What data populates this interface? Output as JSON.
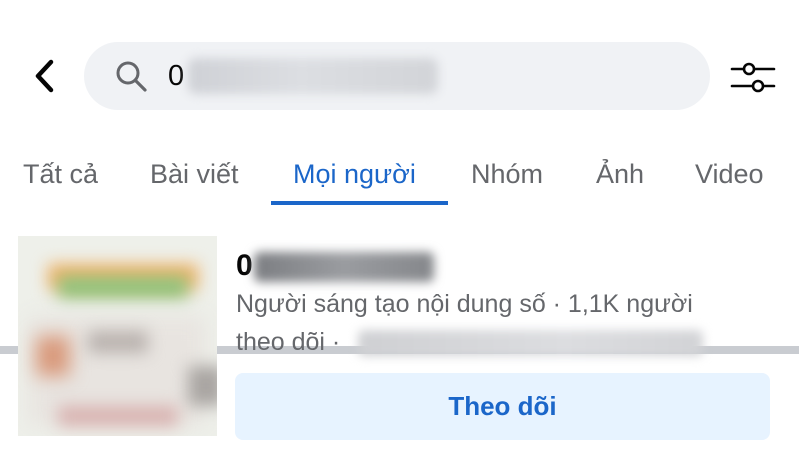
{
  "header": {
    "back_icon": "chevron-left-icon",
    "search": {
      "icon": "search-icon",
      "value": "0",
      "value_redacted": true
    },
    "filter_icon": "sliders-icon"
  },
  "tabs": [
    {
      "label": "Tất cả",
      "active": false
    },
    {
      "label": "Bài viết",
      "active": false
    },
    {
      "label": "Mọi người",
      "active": true
    },
    {
      "label": "Nhóm",
      "active": false
    },
    {
      "label": "Ảnh",
      "active": false
    },
    {
      "label": "Video",
      "active": false
    }
  ],
  "result": {
    "name_prefix": "0",
    "name_redacted": true,
    "meta_line1": "Người sáng tạo nội dung số · 1,1K người",
    "meta_line2": "theo dõi ·",
    "meta_redacted": true,
    "follow_label": "Theo dõi"
  },
  "colors": {
    "accent": "#1b66c9",
    "search_bg": "#f0f2f5",
    "secondary_text": "#65676b",
    "follow_bg": "#e7f3ff",
    "divider": "#c9ccd1"
  }
}
